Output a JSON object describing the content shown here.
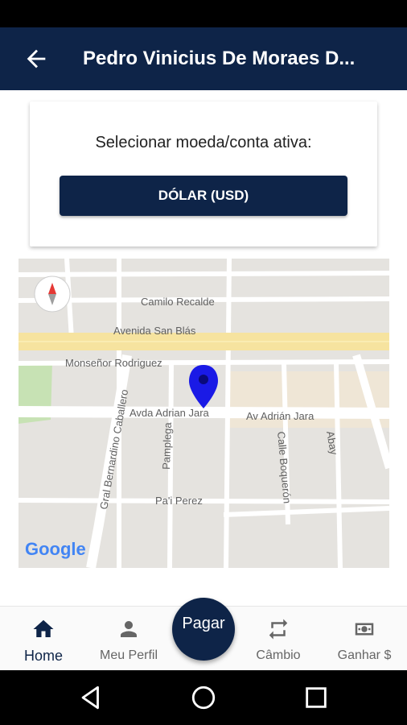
{
  "appbar": {
    "title": "Pedro Vinicius De Moraes D..."
  },
  "card": {
    "label": "Selecionar moeda/conta ativa:",
    "currency_button": "DÓLAR (USD)"
  },
  "map": {
    "streets": [
      "Camilo Recalde",
      "Avenida San Blás",
      "Monseñor Rodriguez",
      "Avda Adrian Jara",
      "Av Adrián Jara",
      "Gral Bernardino Caballero",
      "Pamplega",
      "Calle Boquerón",
      "Abay",
      "Pa'i Perez"
    ],
    "logo": "Google"
  },
  "bottomnav": {
    "items": [
      {
        "label": "Home",
        "icon": "home-icon"
      },
      {
        "label": "Meu Perfil",
        "icon": "person-icon"
      },
      {
        "label": "Câmbio",
        "icon": "swap-icon"
      },
      {
        "label": "Ganhar $",
        "icon": "money-icon"
      }
    ],
    "fab_label": "Pagar"
  },
  "colors": {
    "primary": "#0e2448",
    "map_bg": "#e5e3df",
    "road_main": "#f6e39f",
    "marker": "#1a1ae6"
  }
}
